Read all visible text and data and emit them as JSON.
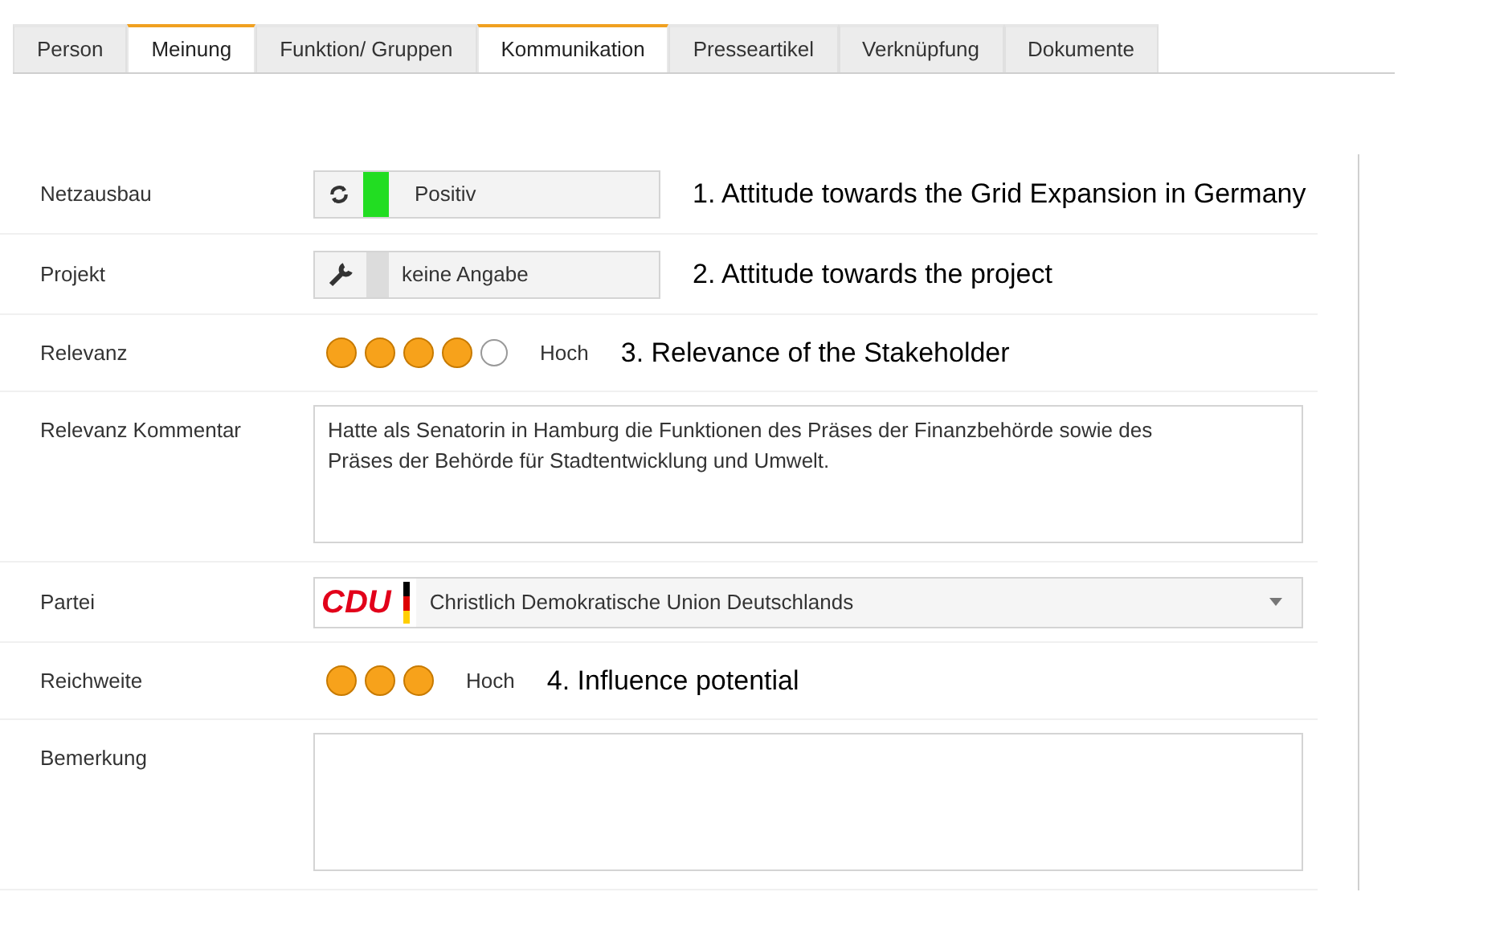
{
  "tabs": [
    {
      "label": "Person",
      "selected": false
    },
    {
      "label": "Meinung",
      "selected": true
    },
    {
      "label": "Funktion/ Gruppen",
      "selected": false
    },
    {
      "label": "Kommunikation",
      "selected": true
    },
    {
      "label": "Presseartikel",
      "selected": false
    },
    {
      "label": "Verknüpfung",
      "selected": false
    },
    {
      "label": "Dokumente",
      "selected": false
    }
  ],
  "rows": [
    {
      "kind": "status",
      "label": "Netzausbau",
      "value": "Positiv",
      "color": "#22dd22",
      "note": "1. Attitude towards the Grid Expansion in Germany"
    },
    {
      "kind": "project",
      "label": "Projekt",
      "value": "keine Angabe",
      "note": "2. Attitude towards the project"
    },
    {
      "kind": "dots",
      "label": "Relevanz",
      "dots": [
        {
          "filled": true
        },
        {
          "filled": true
        },
        {
          "filled": true
        },
        {
          "filled": true
        },
        {
          "filled": false
        }
      ],
      "value": "Hoch",
      "note": "3. Relevance of the Stakeholder"
    },
    {
      "kind": "textarea",
      "label": "Relevanz Kommentar",
      "value": "Hatte als Senatorin in Hamburg die Funktionen des Präses der Finanzbehörde sowie des Präses der Behörde für Stadtentwicklung und Umwelt."
    },
    {
      "kind": "select",
      "label": "Partei",
      "logo": "CDU",
      "value": "Christlich Demokratische Union Deutschlands"
    },
    {
      "kind": "dots",
      "label": "Reichweite",
      "dots": [
        {
          "filled": true
        },
        {
          "filled": true
        },
        {
          "filled": true
        }
      ],
      "value": "Hoch",
      "note": "4. Influence potential"
    },
    {
      "kind": "textarea",
      "label": "Bemerkung"
    }
  ]
}
